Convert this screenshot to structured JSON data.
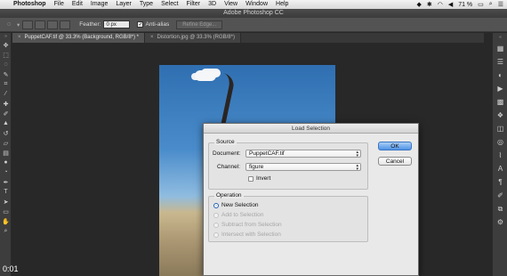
{
  "menubar": {
    "apple_icon": "apple-logo-icon",
    "items": [
      "Photoshop",
      "File",
      "Edit",
      "Image",
      "Layer",
      "Type",
      "Select",
      "Filter",
      "3D",
      "View",
      "Window",
      "Help"
    ],
    "battery": "71 %",
    "status_icons": [
      "dropbox-icon",
      "bluetooth-icon",
      "wifi-icon",
      "volume-icon",
      "battery-icon",
      "search-icon",
      "list-icon"
    ]
  },
  "window": {
    "title": "Adobe Photoshop CC"
  },
  "options": {
    "feather_label": "Feather:",
    "feather_value": "0 px",
    "antialias_label": "Anti-alias",
    "refine_edge_label": "Refine Edge..."
  },
  "tabs": [
    {
      "label": "PuppetCAF.tif @ 33.3% (Background, RGB/8*) *",
      "active": true
    },
    {
      "label": "Distortion.jpg @ 33.3% (RGB/8*)",
      "active": false
    }
  ],
  "video": {
    "timestamp": "0:01"
  },
  "dialog": {
    "title": "Load Selection",
    "source": {
      "label": "Source",
      "document_label": "Document:",
      "document_value": "PuppetCAF.tif",
      "channel_label": "Channel:",
      "channel_value": "figure",
      "invert_label": "Invert"
    },
    "operation": {
      "label": "Operation",
      "options": [
        "New Selection",
        "Add to Selection",
        "Subtract from Selection",
        "Intersect with Selection"
      ],
      "selected": "New Selection"
    },
    "ok_label": "OK",
    "cancel_label": "Cancel"
  }
}
